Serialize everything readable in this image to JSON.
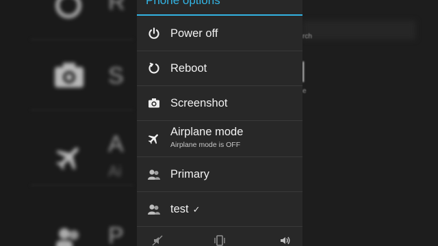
{
  "dialog": {
    "title": "Phone options",
    "items": [
      {
        "label": "Power off",
        "icon": "power-icon"
      },
      {
        "label": "Reboot",
        "icon": "reboot-icon"
      },
      {
        "label": "Screenshot",
        "icon": "camera-icon"
      },
      {
        "label": "Airplane mode",
        "sublabel": "Airplane mode is OFF",
        "icon": "airplane-icon"
      },
      {
        "label": "Primary",
        "icon": "user-icon"
      },
      {
        "label": "test",
        "icon": "user-icon",
        "checked": true
      }
    ],
    "bottom_icons": [
      "silent-icon",
      "vibrate-icon",
      "sound-icon"
    ],
    "accent_color": "#33b5e5"
  },
  "background": {
    "blur_text": [
      "R",
      "S",
      "A",
      "Ai",
      "P"
    ],
    "right_text": "rch",
    "right_text2": "e"
  }
}
